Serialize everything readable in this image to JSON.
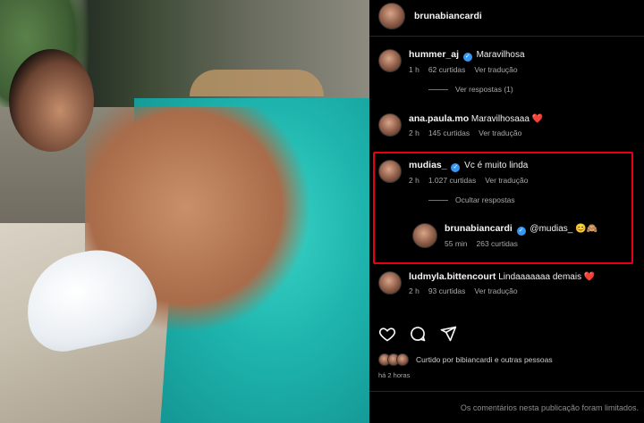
{
  "post": {
    "author": "brunabiancardi",
    "photo_alt": "post-photo"
  },
  "comments": [
    {
      "username": "hummer_aj",
      "verified": true,
      "text": "Maravilhosa",
      "time": "1 h",
      "likes": "62 curtidas",
      "translate": "Ver tradução",
      "replies_link": "Ver respostas (1)"
    },
    {
      "username": "ana.paula.mo",
      "verified": false,
      "text": "Maravilhosaaa",
      "emoji": "❤️",
      "time": "2 h",
      "likes": "145 curtidas",
      "translate": "Ver tradução"
    },
    {
      "username": "mudias_",
      "verified": true,
      "text": "Vc é muito linda",
      "time": "2 h",
      "likes": "1.027 curtidas",
      "translate": "Ver tradução",
      "replies_link": "Ocultar respostas"
    },
    {
      "username": "brunabiancardi",
      "verified": true,
      "text": "@mudias_",
      "emoji": "😊🙈",
      "time": "55 min",
      "likes": "263 curtidas"
    },
    {
      "username": "ludmyla.bittencourt",
      "verified": false,
      "text": "Lindaaaaaaa demais",
      "emoji": "❤️",
      "time": "2 h",
      "likes": "93 curtidas",
      "translate": "Ver tradução"
    }
  ],
  "actions": {
    "like_icon": "heart-icon",
    "comment_icon": "comment-icon",
    "share_icon": "share-icon"
  },
  "likes_summary": "Curtido por bibiancardi e outras pessoas",
  "posted_ago": "há 2 horas",
  "comments_limited": "Os comentários nesta publicação foram limitados.",
  "colors": {
    "highlight_border": "#e60012",
    "verified": "#3897f0",
    "background": "#000000"
  }
}
